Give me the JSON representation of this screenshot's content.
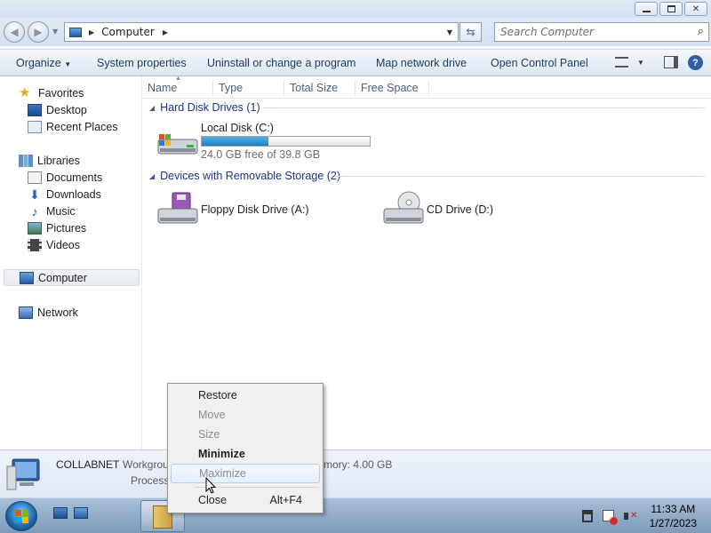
{
  "window": {
    "caption_buttons": [
      "minimize-icon",
      "restore-icon",
      "close-icon"
    ]
  },
  "address": {
    "location": "Computer",
    "search_placeholder": "Search Computer"
  },
  "toolbar": {
    "organize": "Organize",
    "system_properties": "System properties",
    "uninstall": "Uninstall or change a program",
    "map_drive": "Map network drive",
    "control_panel": "Open Control Panel"
  },
  "nav": {
    "favorites": "Favorites",
    "desktop": "Desktop",
    "recent_places": "Recent Places",
    "libraries": "Libraries",
    "documents": "Documents",
    "downloads": "Downloads",
    "music": "Music",
    "pictures": "Pictures",
    "videos": "Videos",
    "computer": "Computer",
    "network": "Network"
  },
  "columns": [
    "Name",
    "Type",
    "Total Size",
    "Free Space"
  ],
  "groups": {
    "hard_disks": "Hard Disk Drives (1)",
    "removable": "Devices with Removable Storage (2)"
  },
  "drives": {
    "local_disk": {
      "name": "Local Disk (C:)",
      "free_text": "24.0 GB free of 39.8 GB",
      "used_fraction": 0.397
    },
    "floppy": {
      "name": "Floppy Disk Drive (A:)"
    },
    "cd": {
      "name": "CD Drive (D:)"
    }
  },
  "details": {
    "computer_name": "COLLABNET",
    "workgroup_label": "Workgrou",
    "memory_label": "mory: 4.00 GB",
    "processor_label": "Process"
  },
  "context_menu": {
    "restore": "Restore",
    "move": "Move",
    "size": "Size",
    "minimize": "Minimize",
    "maximize": "Maximize",
    "close": "Close",
    "close_shortcut": "Alt+F4"
  },
  "clock": {
    "time": "11:33 AM",
    "date": "1/27/2023"
  },
  "colors": {
    "accent": "#1e3287",
    "capacity_fill": "#1d7fc4"
  }
}
